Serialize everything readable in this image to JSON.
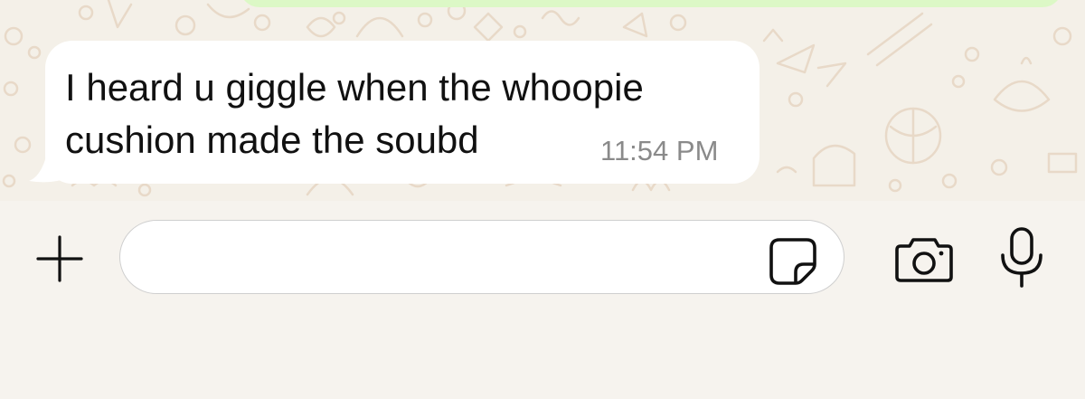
{
  "conversation": {
    "incoming_message": {
      "text_lines": [
        "I heard u giggle when the whoopie",
        "cushion made the soubd"
      ],
      "time": "11:54 PM"
    }
  },
  "composer": {
    "input_value": "",
    "placeholder": ""
  },
  "icons": {
    "plus": "plus-icon",
    "sticker": "sticker-icon",
    "camera": "camera-icon",
    "microphone": "microphone-icon"
  },
  "colors": {
    "chat_background": "#f4f0e8",
    "incoming_bubble": "#ffffff",
    "outgoing_bubble": "#dcf8c6",
    "composer_background": "#f6f3ee",
    "timestamp": "#8a8a8a",
    "icon": "#111111"
  }
}
